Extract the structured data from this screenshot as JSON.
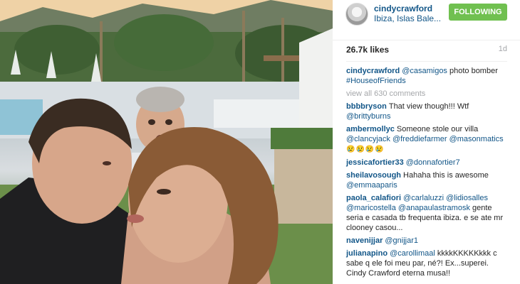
{
  "post": {
    "username": "cindycrawford",
    "location": "Ibiza, Islas Bale...",
    "follow_label": "FOLLOWING",
    "likes": "26.7k likes",
    "age": "1d",
    "caption": {
      "user": "cindycrawford",
      "mention": "@casamigos",
      "text": " photo bomber ",
      "hashtag": "#HouseofFriends"
    },
    "view_all": "view all 630 comments"
  },
  "comments": [
    {
      "user": "bbbbryson",
      "text": "That view though!!! Wtf ",
      "mention": "@brittyburns"
    },
    {
      "user": "ambermollyc",
      "text": "Someone stole our villa ",
      "mention": "@clancyjack @freddiefarmer @masonmatics",
      "emoji": "😢😢😢😢"
    },
    {
      "user": "jessicafortier33",
      "text": "",
      "mention": "@donnafortier7"
    },
    {
      "user": "sheilavosough",
      "text": "Hahaha this is awesome ",
      "mention": "@emmaaparis"
    },
    {
      "user": "paola_calafiori",
      "text": "",
      "mention": "@carlaluzzi @lidiosalles @maricostella @anapaulastramosk",
      "text2": " gente seria e casada tb frequenta ibiza. e se ate mr clooney casou..."
    },
    {
      "user": "navenijjar",
      "text": "",
      "mention": "@gnijjar1"
    },
    {
      "user": "julianapino",
      "text": "",
      "mention": "@carollimaal",
      "text2": " kkkkKKKKKkkk c sabe q ele foi meu par, né?! Ex...superei. Cindy Crawford eterna musa!!"
    }
  ],
  "icons": {
    "avatar": "profile-avatar"
  },
  "colors": {
    "link": "#125688",
    "follow_bg": "#70c050",
    "muted": "#a5a7aa"
  }
}
